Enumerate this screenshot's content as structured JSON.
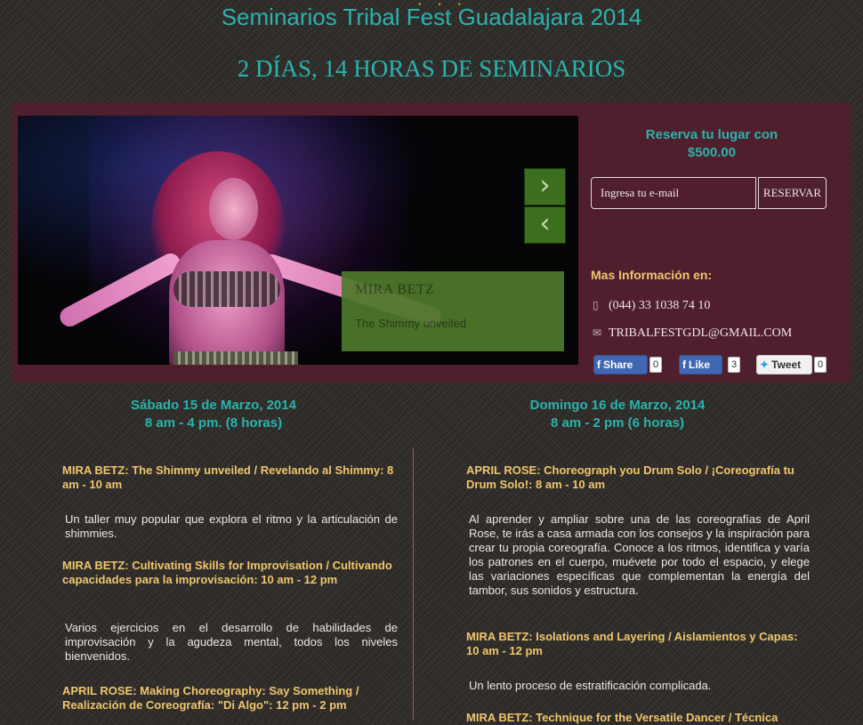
{
  "header": {
    "title": "Seminarios Tribal Fest Guadalajara 2014",
    "subtitle": "2 DÍAS, 14 HORAS DE SEMINARIOS"
  },
  "slider": {
    "next_icon": "chevron-right-icon",
    "prev_icon": "chevron-left-icon",
    "caption": {
      "name": "MIRA BETZ",
      "talk": "The Shimmy unveiled"
    }
  },
  "reservation": {
    "line1": "Reserva tu lugar con",
    "line2": "$500.00",
    "email_placeholder": "Ingresa tu e-mail",
    "button_label": "RESERVAR"
  },
  "contact": {
    "heading": "Mas Información en:",
    "phone": "(044) 33 1038 74 10",
    "email": "TRIBALFESTGDL@GMAIL.COM"
  },
  "social": {
    "share_label": "Share",
    "share_count": "0",
    "like_label": "Like",
    "like_count": "3",
    "tweet_label": "Tweet",
    "tweet_count": "0"
  },
  "days": [
    {
      "date": "Sábado 15 de Marzo, 2014",
      "hours": "8 am - 4 pm. (8 horas)",
      "sessions": [
        {
          "title": "MIRA BETZ: The Shimmy unveiled / Revelando al Shimmy: 8 am - 10 am",
          "desc": "Un taller muy popular que explora el ritmo y la articulación de shimmies."
        },
        {
          "title": "MIRA BETZ: Cultivating Skills for Improvisation / Cultivando capacidades para la improvisación: 10 am - 12 pm",
          "desc": "Varios ejercicios en el desarrollo de habilidades de improvisación y la agudeza mental, todos los niveles bienvenidos."
        },
        {
          "title": "APRIL ROSE: Making Choreography: Say Something / Realización de Coreografía: \"Di Algo\": 12 pm - 2 pm",
          "desc": ""
        }
      ]
    },
    {
      "date": "Domingo 16 de Marzo, 2014",
      "hours": "8 am - 2 pm (6 horas)",
      "sessions": [
        {
          "title": "APRIL ROSE: Choreograph you Drum Solo / ¡Coreografía tu Drum Solo!: 8 am - 10 am",
          "desc": "Al aprender y ampliar sobre una de las coreografías de April Rose, te irás a casa armada con los consejos y la inspiración para crear tu propia coreografía. Conoce a los ritmos, identifica y varía los patrones en el cuerpo, muévete por todo el espacio, y elege las variaciones específicas que complementan la energía del tambor, sus sonidos y estructura."
        },
        {
          "title": "MIRA BETZ: Isolations and Layering / Aislamientos y Capas: 10 am - 12 pm",
          "desc": "Un lento proceso de estratificación complicada."
        },
        {
          "title": "MIRA BETZ: Technique for the Versatile Dancer / Técnica",
          "desc": ""
        }
      ]
    }
  ]
}
